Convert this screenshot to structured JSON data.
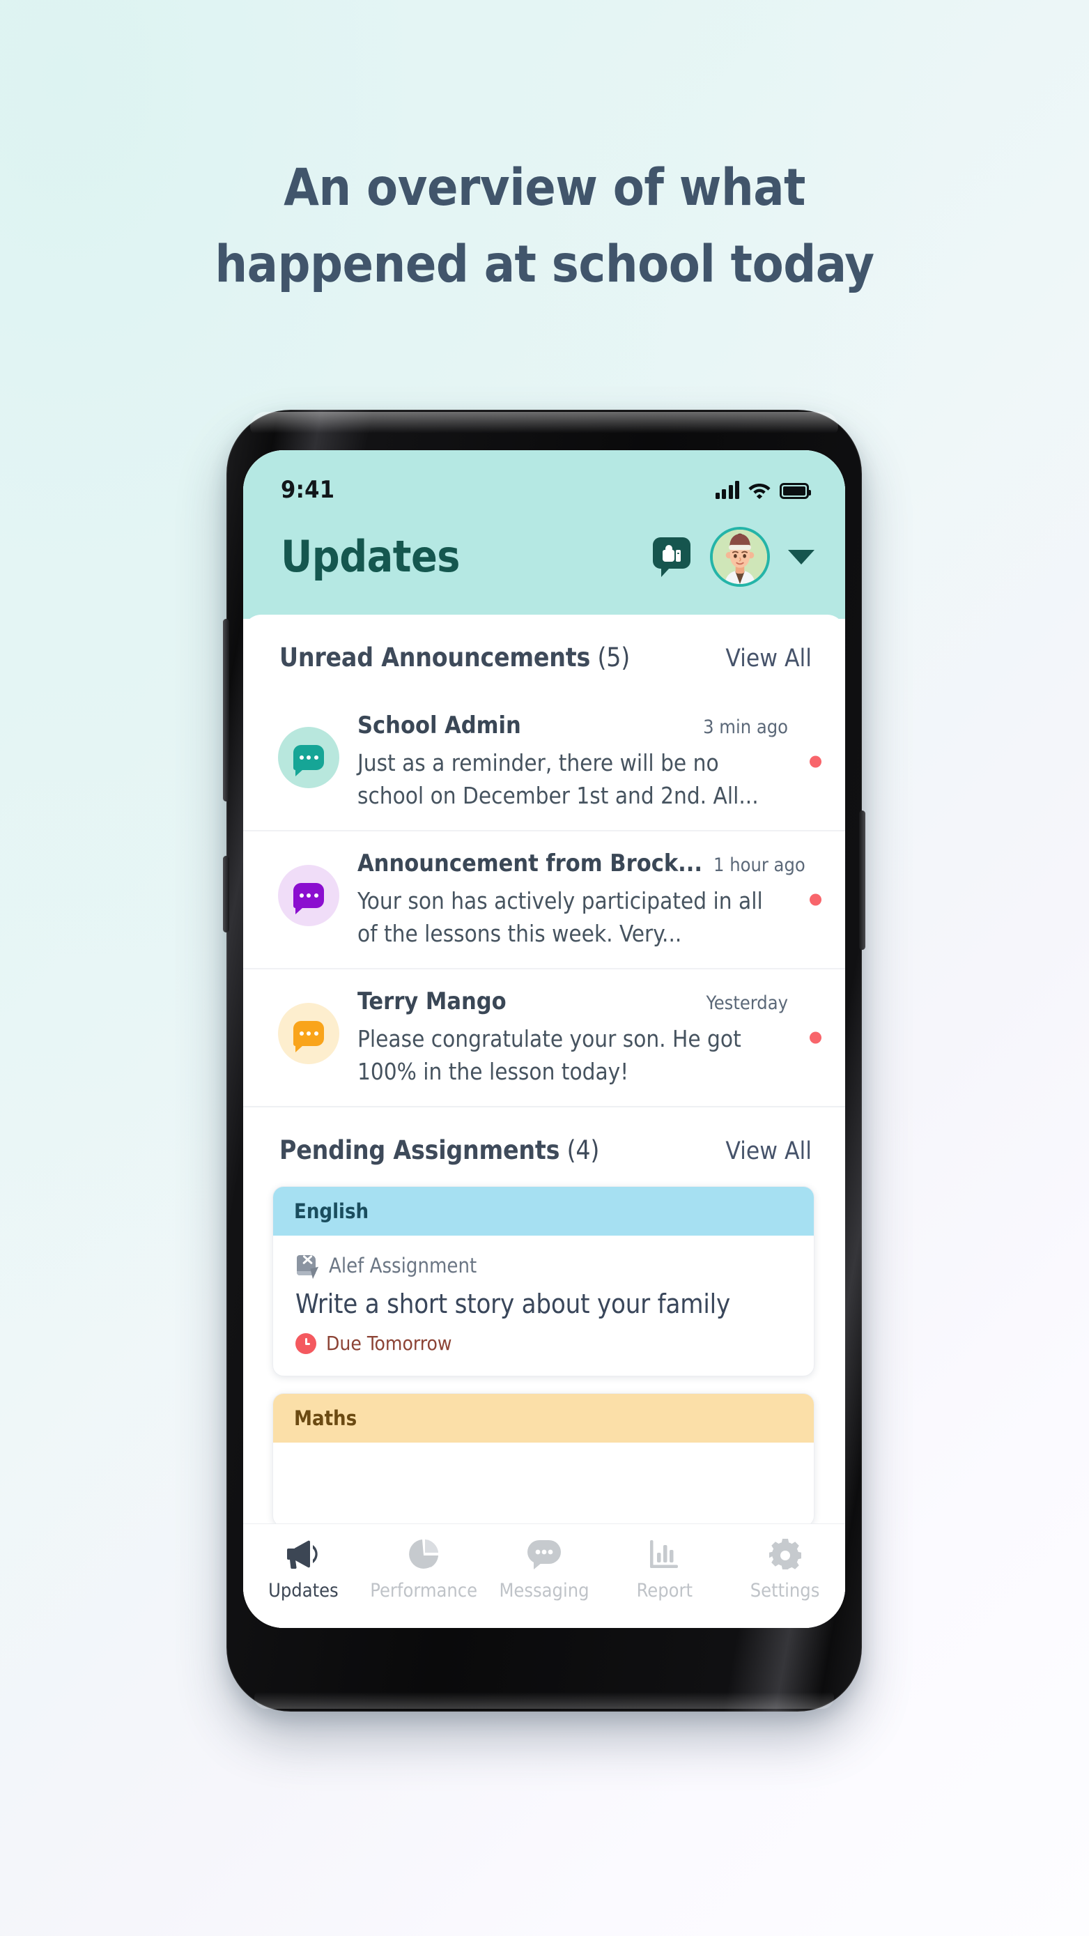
{
  "headline": {
    "line1": "An overview of what",
    "line2": "happened at school today",
    "color": "#41556b"
  },
  "statusbar": {
    "time": "9:41",
    "signal_icon": "signal-bars-icon",
    "wifi_icon": "wifi-icon",
    "battery_icon": "battery-full-icon"
  },
  "header": {
    "title": "Updates",
    "feedback_icon": "speech-bubble-thumbs-up-icon",
    "avatar_icon": "student-avatar",
    "chevron_icon": "chevron-down-icon",
    "title_color": "#15574f",
    "background": "#b5e8e3"
  },
  "announcements": {
    "title_bold": "Unread Announcements",
    "title_count": " (5)",
    "view_all": "View All",
    "items": [
      {
        "name": "School Admin",
        "time": "3 min ago",
        "text": "Just as a reminder, there will be no school on December 1st and 2nd. All...",
        "icon": "chat-bubble-icon",
        "icon_color": "#16a596",
        "icon_bg": "#b8e7dd",
        "unread": true
      },
      {
        "name": "Announcement from Brock...",
        "time": "1 hour ago",
        "text": "Your son has actively participated in all of the lessons this week. Very...",
        "icon": "chat-bubble-icon",
        "icon_color": "#8b0fcf",
        "icon_bg": "#f0ddf8",
        "unread": true
      },
      {
        "name": "Terry Mango",
        "time": "Yesterday",
        "text": "Please congratulate your son. He got 100% in the lesson today!",
        "icon": "chat-bubble-icon",
        "icon_color": "#f9a41b",
        "icon_bg": "#fdeece",
        "unread": true
      }
    ]
  },
  "assignments": {
    "title_bold": "Pending Assignments",
    "title_count": " (4)",
    "view_all": "View All",
    "cards": [
      {
        "subject": "English",
        "subject_bg": "#a6e0f2",
        "kind": "Alef Assignment",
        "kind_icon": "assignment-book-icon",
        "title": "Write a short story about your family",
        "due": "Due Tomorrow",
        "due_icon": "clock-icon"
      },
      {
        "subject": "Maths",
        "subject_bg": "#fbdfa8"
      }
    ]
  },
  "tabbar": {
    "tabs": [
      {
        "label": "Updates",
        "icon": "megaphone-icon",
        "active": true
      },
      {
        "label": "Performance",
        "icon": "pie-chart-icon",
        "active": false
      },
      {
        "label": "Messaging",
        "icon": "chat-dots-icon",
        "active": false
      },
      {
        "label": "Report",
        "icon": "bar-chart-icon",
        "active": false
      },
      {
        "label": "Settings",
        "icon": "gear-icon",
        "active": false
      }
    ]
  }
}
